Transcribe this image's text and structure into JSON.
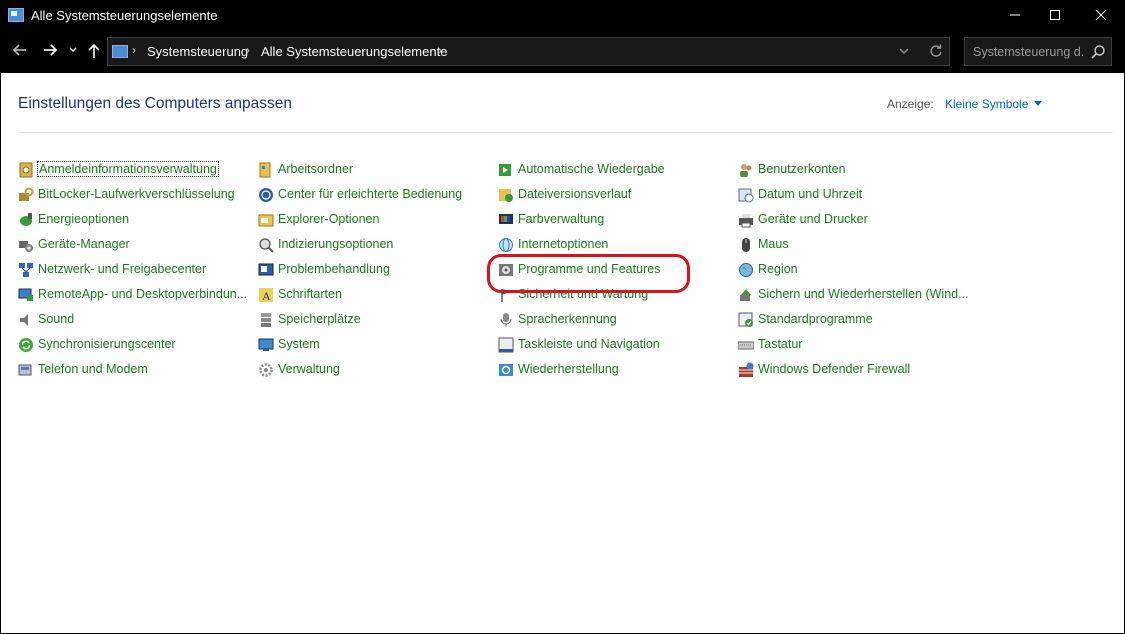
{
  "window": {
    "title": "Alle Systemsteuerungselemente",
    "controls": {
      "minimize": "—",
      "maximize": "☐",
      "close": "✕"
    }
  },
  "address": {
    "breadcrumbs": [
      "Systemsteuerung",
      "Alle Systemsteuerungselemente"
    ],
    "search_placeholder": "Systemsteuerung d..."
  },
  "content": {
    "heading": "Einstellungen des Computers anpassen",
    "view_label": "Anzeige:",
    "view_value": "Kleine Symbole"
  },
  "items": {
    "col1": [
      {
        "label": "Anmeldeinformationsverwaltung",
        "icon": "credential-manager-icon"
      },
      {
        "label": "BitLocker-Laufwerkverschlüsselung",
        "icon": "bitlocker-icon"
      },
      {
        "label": "Energieoptionen",
        "icon": "power-options-icon"
      },
      {
        "label": "Geräte-Manager",
        "icon": "device-manager-icon"
      },
      {
        "label": "Netzwerk- und Freigabecenter",
        "icon": "network-icon"
      },
      {
        "label": "RemoteApp- und Desktopverbindun...",
        "icon": "remoteapp-icon"
      },
      {
        "label": "Sound",
        "icon": "speaker-icon"
      },
      {
        "label": "Synchronisierungscenter",
        "icon": "sync-icon"
      },
      {
        "label": "Telefon und Modem",
        "icon": "phone-modem-icon"
      }
    ],
    "col2": [
      {
        "label": "Arbeitsordner",
        "icon": "work-folders-icon"
      },
      {
        "label": "Center für erleichterte Bedienung",
        "icon": "ease-of-access-icon"
      },
      {
        "label": "Explorer-Optionen",
        "icon": "folder-options-icon"
      },
      {
        "label": "Indizierungsoptionen",
        "icon": "indexing-icon"
      },
      {
        "label": "Problembehandlung",
        "icon": "troubleshooting-icon"
      },
      {
        "label": "Schriftarten",
        "icon": "fonts-icon"
      },
      {
        "label": "Speicherplätze",
        "icon": "storage-spaces-icon"
      },
      {
        "label": "System",
        "icon": "system-icon"
      },
      {
        "label": "Verwaltung",
        "icon": "administrative-tools-icon"
      }
    ],
    "col3": [
      {
        "label": "Automatische Wiedergabe",
        "icon": "autoplay-icon"
      },
      {
        "label": "Dateiversionsverlauf",
        "icon": "file-history-icon"
      },
      {
        "label": "Farbverwaltung",
        "icon": "color-management-icon"
      },
      {
        "label": "Internetoptionen",
        "icon": "internet-options-icon"
      },
      {
        "label": "Programme und Features",
        "icon": "programs-features-icon"
      },
      {
        "label": "Sicherheit und Wartung",
        "icon": "security-maintenance-icon"
      },
      {
        "label": "Spracherkennung",
        "icon": "microphone-icon"
      },
      {
        "label": "Taskleiste und Navigation",
        "icon": "taskbar-icon"
      },
      {
        "label": "Wiederherstellung",
        "icon": "recovery-icon"
      }
    ],
    "col4": [
      {
        "label": "Benutzerkonten",
        "icon": "user-accounts-icon"
      },
      {
        "label": "Datum und Uhrzeit",
        "icon": "date-time-icon"
      },
      {
        "label": "Geräte und Drucker",
        "icon": "devices-printers-icon"
      },
      {
        "label": "Maus",
        "icon": "mouse-icon"
      },
      {
        "label": "Region",
        "icon": "region-icon"
      },
      {
        "label": "Sichern und Wiederherstellen (Wind...",
        "icon": "backup-restore-icon"
      },
      {
        "label": "Standardprogramme",
        "icon": "default-programs-icon"
      },
      {
        "label": "Tastatur",
        "icon": "keyboard-icon"
      },
      {
        "label": "Windows Defender Firewall",
        "icon": "firewall-icon"
      }
    ]
  },
  "colors": {
    "link_green": "#1e7a1e",
    "heading_blue": "#1e3287",
    "highlight_red": "#d8141c"
  }
}
